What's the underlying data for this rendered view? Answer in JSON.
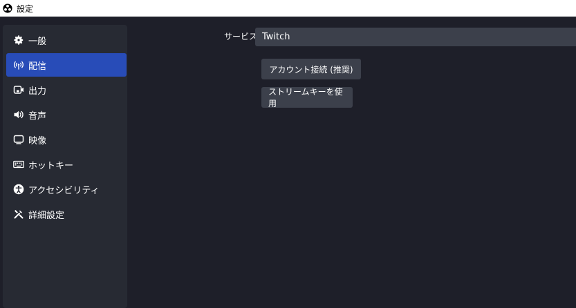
{
  "window": {
    "title": "設定"
  },
  "sidebar": {
    "items": [
      {
        "label": "一般",
        "icon": "gear-icon",
        "active": false
      },
      {
        "label": "配信",
        "icon": "broadcast-antenna-icon",
        "active": true
      },
      {
        "label": "出力",
        "icon": "output-camera-icon",
        "active": false
      },
      {
        "label": "音声",
        "icon": "speaker-icon",
        "active": false
      },
      {
        "label": "映像",
        "icon": "monitor-icon",
        "active": false
      },
      {
        "label": "ホットキー",
        "icon": "keyboard-icon",
        "active": false
      },
      {
        "label": "アクセシビリティ",
        "icon": "accessibility-icon",
        "active": false
      },
      {
        "label": "詳細設定",
        "icon": "tools-icon",
        "active": false
      }
    ]
  },
  "stream": {
    "service_label": "サービス",
    "service_value": "Twitch",
    "connect_account_button": "アカウント接続 (推奨)",
    "use_stream_key_button": "ストリームキーを使用"
  },
  "colors": {
    "accent": "#284cb8",
    "background": "#1e1f29",
    "panel": "#272a33",
    "control": "#3c404b"
  }
}
